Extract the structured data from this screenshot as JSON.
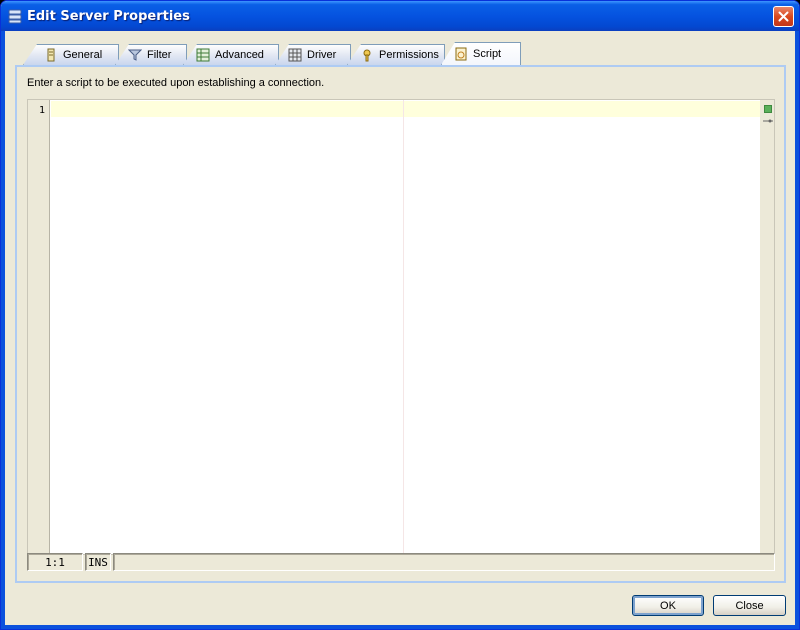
{
  "window": {
    "title": "Edit Server Properties"
  },
  "tabs": [
    {
      "label": "General",
      "icon": "general-icon"
    },
    {
      "label": "Filter",
      "icon": "filter-icon"
    },
    {
      "label": "Advanced",
      "icon": "advanced-icon"
    },
    {
      "label": "Driver",
      "icon": "driver-icon"
    },
    {
      "label": "Permissions",
      "icon": "permissions-icon"
    },
    {
      "label": "Script",
      "icon": "script-icon",
      "active": true
    }
  ],
  "panel": {
    "instructions": "Enter a script to be executed upon establishing a connection."
  },
  "editor": {
    "line_number": "1",
    "content": ""
  },
  "statusbar": {
    "position": "1:1",
    "mode": "INS",
    "message": ""
  },
  "buttons": {
    "ok": "OK",
    "close": "Close"
  },
  "colors": {
    "titlebar": "#0553e0",
    "current_line": "#ffffdc",
    "marker": "#5ab05a"
  }
}
